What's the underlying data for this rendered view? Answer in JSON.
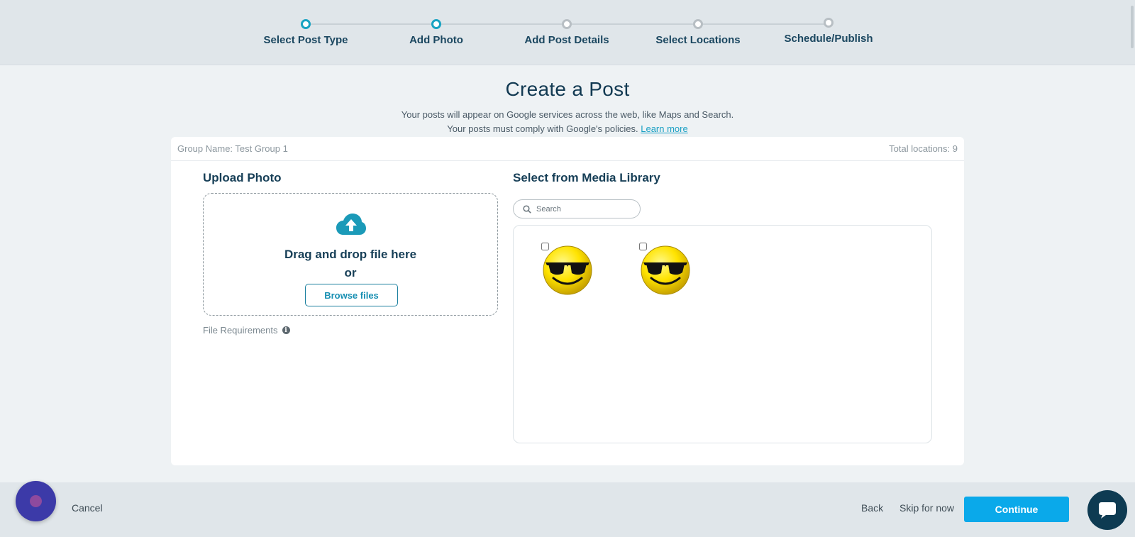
{
  "stepper": {
    "steps": [
      {
        "label": "Select Post Type",
        "state": "active"
      },
      {
        "label": "Add Photo",
        "state": "active"
      },
      {
        "label": "Add Post Details",
        "state": "inactive"
      },
      {
        "label": "Select Locations",
        "state": "inactive"
      },
      {
        "label": "Schedule/Publish",
        "state": "inactive"
      }
    ]
  },
  "page": {
    "title": "Create a Post",
    "subtitle_line1": "Your posts will appear on Google services across the web, like Maps and Search.",
    "subtitle_line2": "Your posts must comply with Google's policies.",
    "learn_more": "Learn more"
  },
  "card": {
    "group_name": "Group Name: Test Group 1",
    "total_locations": "Total locations: 9"
  },
  "upload": {
    "title": "Upload Photo",
    "drop_text": "Drag and drop file here",
    "or_text": "or",
    "browse_label": "Browse files",
    "requirements": "File Requirements",
    "upload_icon": "cloud-upload-icon"
  },
  "media_library": {
    "title": "Select from Media Library",
    "search_placeholder": "Search",
    "items": [
      {
        "icon": "sunglasses-smiley-image",
        "checked": false
      },
      {
        "icon": "sunglasses-smiley-image",
        "checked": false
      }
    ]
  },
  "footer": {
    "cancel": "Cancel",
    "back": "Back",
    "skip": "Skip for now",
    "continue": "Continue"
  },
  "colors": {
    "accent": "#18a3c2",
    "continue": "#0aa9ea",
    "title": "#123a52"
  }
}
